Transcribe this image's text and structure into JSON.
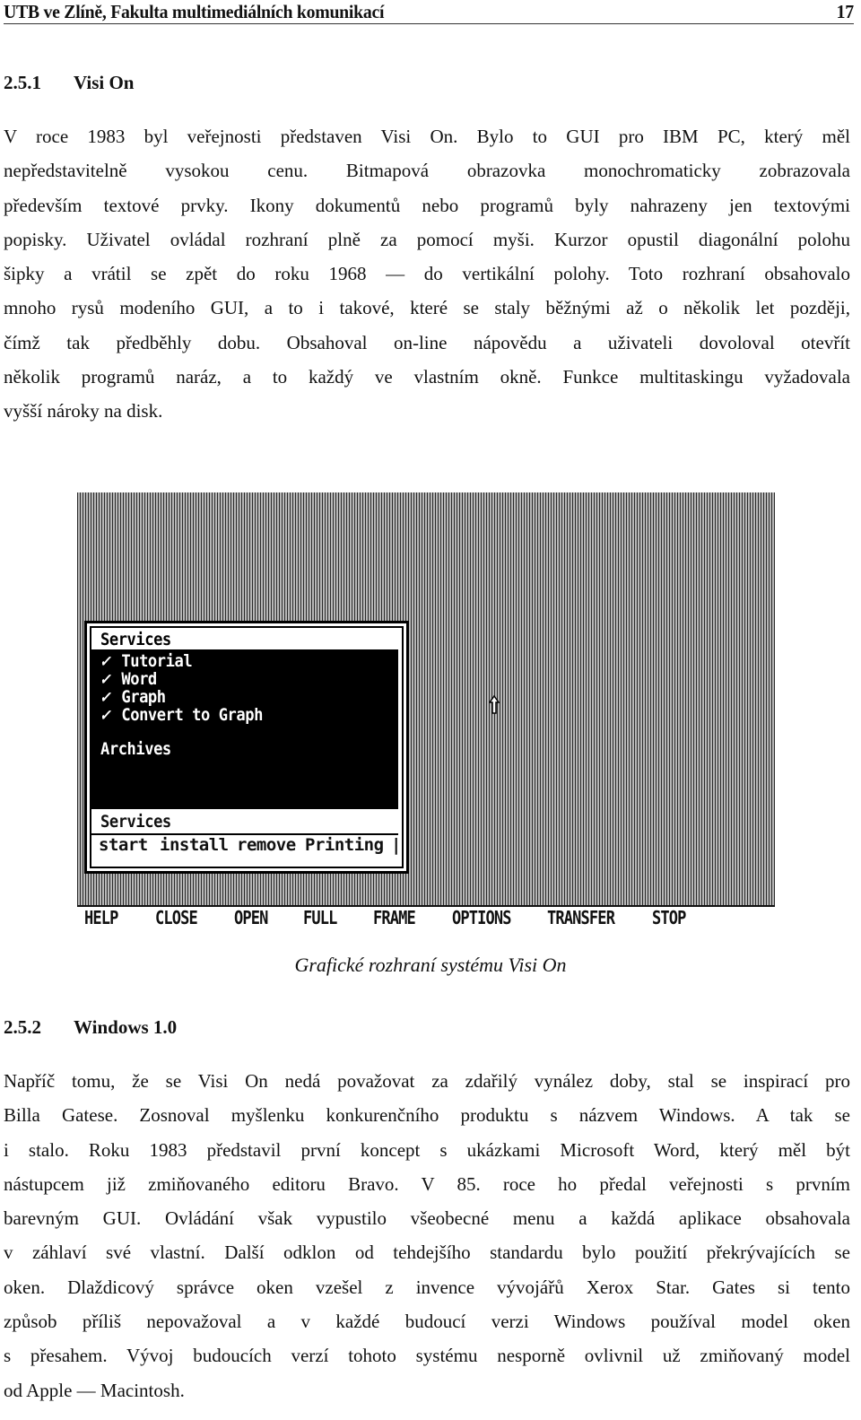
{
  "header": {
    "title": "UTB ve Zlíně, Fakulta multimediálních komunikací",
    "page_number": "17"
  },
  "section1": {
    "number": "2.5.1",
    "title": "Visi On",
    "lines": [
      "V roce 1983 byl veřejnosti představen Visi On. Bylo to GUI pro IBM PC, který měl",
      "nepředstavitelně vysokou cenu. Bitmapová obrazovka monochromaticky zobrazovala",
      "především textové prvky. Ikony dokumentů nebo programů byly nahrazeny jen textovými",
      "popisky. Uživatel ovládal rozhraní plně za pomocí myši. Kurzor opustil diagonální polohu",
      "šipky a vrátil se zpět do roku 1968 — do vertikální polohy. Toto rozhraní obsahovalo",
      "mnoho rysů modeního GUI, a to i takové, které se staly běžnými až o několik let později,",
      "čímž tak předběhly dobu. Obsahoval on-line nápovědu a uživateli dovoloval otevřít",
      "několik programů naráz, a to každý ve vlastním okně. Funkce multitaskingu vyžadovala",
      "vyšší nároky na disk."
    ]
  },
  "figure": {
    "window": {
      "title": "Services",
      "items": [
        {
          "check": "✓",
          "label": "Tutorial"
        },
        {
          "check": "✓",
          "label": "Word"
        },
        {
          "check": "✓",
          "label": "Graph"
        },
        {
          "check": "✓",
          "label": "Convert to Graph"
        }
      ],
      "archives_label": "Archives",
      "status_label": "Services",
      "commands": [
        "start",
        "install",
        "remove",
        "Printing",
        "|"
      ]
    },
    "menubar": [
      "HELP",
      "CLOSE",
      "OPEN",
      "FULL",
      "FRAME",
      "OPTIONS",
      "TRANSFER",
      "STOP"
    ],
    "cursor_icon": "up-arrow-cursor",
    "caption": "Grafické rozhraní systému Visi On"
  },
  "section2": {
    "number": "2.5.2",
    "title": "Windows 1.0",
    "lines": [
      "Napříč tomu, že se Visi On nedá považovat za zdařilý vynález doby, stal se inspirací pro",
      "Billa Gatese. Zosnoval myšlenku konkurenčního produktu s názvem Windows. A tak se",
      "i stalo. Roku 1983 představil první koncept s ukázkami Microsoft Word, který měl být",
      "nástupcem již zmiňovaného editoru Bravo. V 85. roce ho předal veřejnosti s prvním",
      "barevným GUI. Ovládání však vypustilo všeobecné menu a každá aplikace obsahovala",
      "v záhlaví své vlastní. Další odklon od tehdejšího standardu bylo použití překrývajících se",
      "oken. Dlaždicový správce oken vzešel z invence vývojářů Xerox Star. Gates si tento",
      "způsob příliš nepovažoval a v každé budoucí verzi Windows používal model oken",
      "s přesahem. Vývoj budoucích verzí tohoto systému nesporně ovlivnil už zmiňovaný model",
      "od Apple — Macintosh."
    ]
  }
}
